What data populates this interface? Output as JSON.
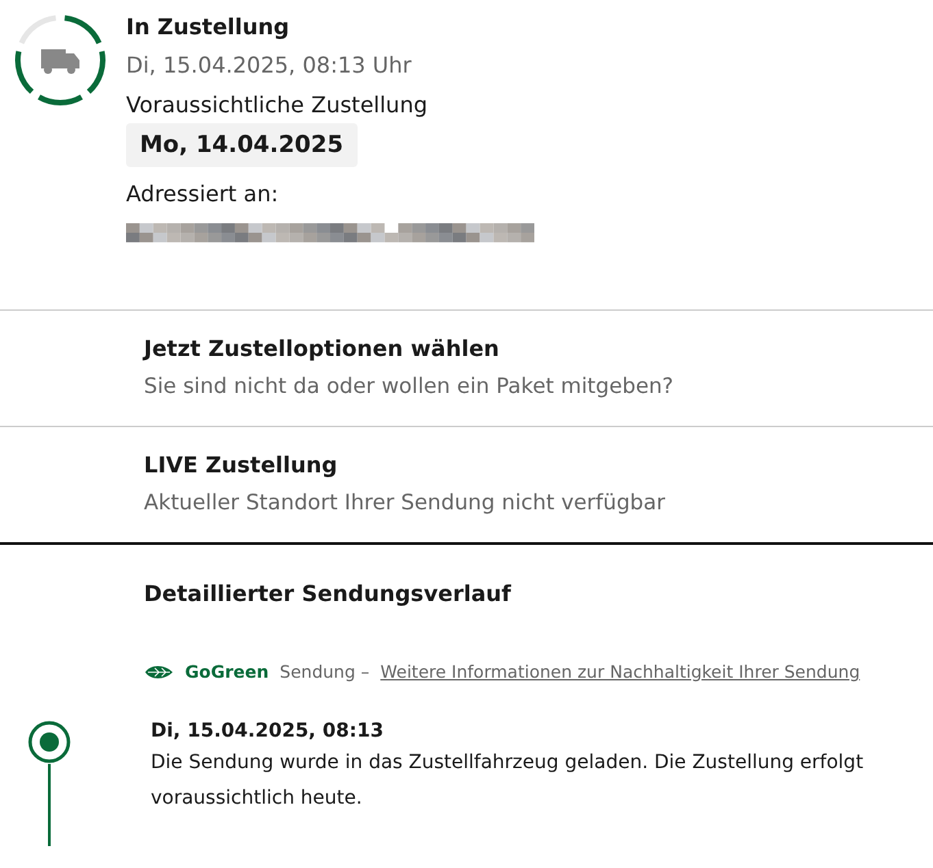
{
  "status": {
    "title": "In Zustellung",
    "timestamp": "Di, 15.04.2025, 08:13 Uhr",
    "expected_label": "Voraussichtliche Zustellung",
    "expected_date": "Mo, 14.04.2025",
    "addressed_label": "Adressiert an:"
  },
  "options": [
    {
      "title": "Jetzt Zustelloptionen wählen",
      "subtitle": "Sie sind nicht da oder wollen ein Paket mitgeben?"
    },
    {
      "title": "LIVE Zustellung",
      "subtitle": "Aktueller Standort Ihrer Sendung nicht verfügbar"
    }
  ],
  "history": {
    "title": "Detaillierter Sendungsverlauf",
    "gogreen": {
      "brand": "GoGreen",
      "text": "Sendung –",
      "link": "Weitere Informationen zur Nachhaltigkeit Ihrer Sendung"
    },
    "events": [
      {
        "time": "Di, 15.04.2025, 08:13",
        "text": "Die Sendung wurde in das Zustellfahrzeug geladen. Die Zustellung erfolgt voraussichtlich heute."
      }
    ]
  }
}
